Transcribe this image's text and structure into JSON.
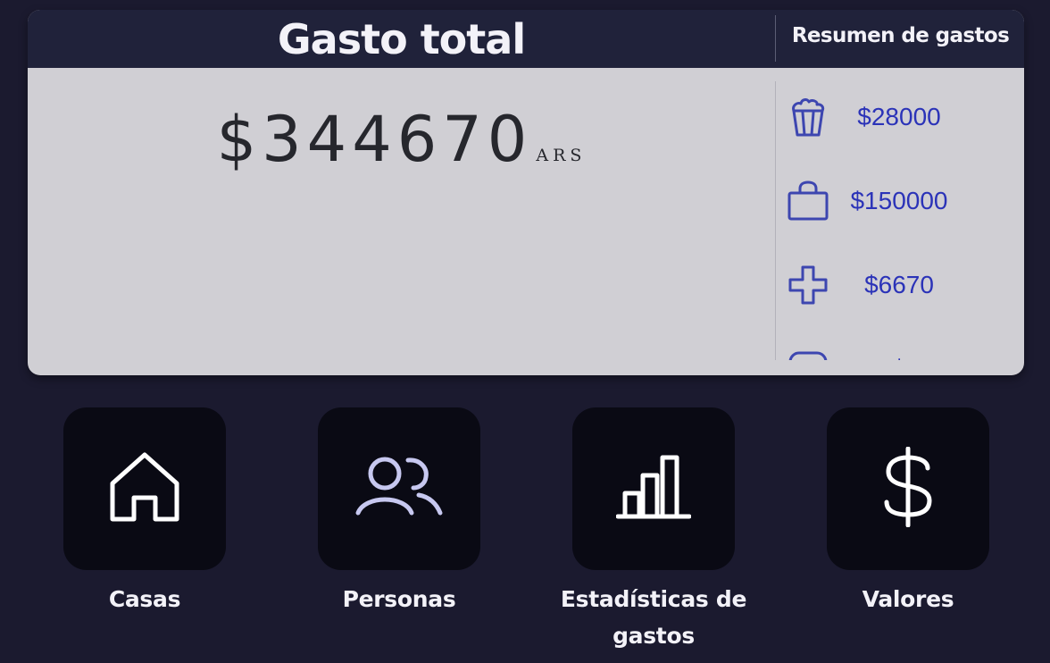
{
  "header": {
    "title": "Gasto total",
    "summary_title": "Resumen de gastos"
  },
  "total": {
    "amount": "$344670",
    "currency": "ARS"
  },
  "summary": {
    "items": [
      {
        "icon": "popcorn-icon",
        "amount": "$28000"
      },
      {
        "icon": "shopping-bag-icon",
        "amount": "$150000"
      },
      {
        "icon": "medical-cross-icon",
        "amount": "$6670"
      },
      {
        "icon": "partial-icon",
        "amount": "$"
      }
    ]
  },
  "colors": {
    "background": "#1b1a2f",
    "card": "#d0cfd4",
    "header": "#20223a",
    "accent": "#2b33b8",
    "tile": "#0a0a14"
  },
  "nav": {
    "items": [
      {
        "label": "Casas",
        "icon": "house-icon"
      },
      {
        "label": "Personas",
        "icon": "people-icon"
      },
      {
        "label": "Estadísticas de gastos",
        "icon": "bar-chart-icon"
      },
      {
        "label": "Valores",
        "icon": "dollar-icon"
      }
    ]
  }
}
